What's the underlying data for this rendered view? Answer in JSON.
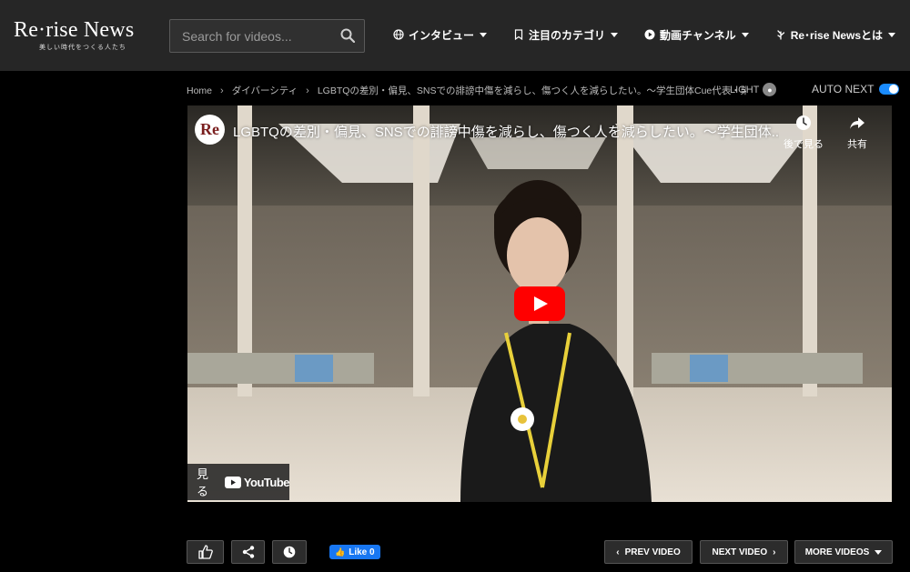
{
  "header": {
    "logo_main": "Re·rise News",
    "logo_sub": "美しい時代をつくる人たち",
    "search_placeholder": "Search for videos...",
    "nav": [
      {
        "label": "インタビュー",
        "icon": "globe-icon"
      },
      {
        "label": "注目のカテゴリ",
        "icon": "bookmark-icon"
      },
      {
        "label": "動画チャンネル",
        "icon": "play-circle-icon"
      },
      {
        "label": "Re･rise Newsとは",
        "icon": "leaf-icon"
      }
    ]
  },
  "breadcrumb": {
    "home": "Home",
    "category": "ダイバーシティ",
    "current": "LGBTQの差別・偏見、SNSでの誹謗中傷を減らし、傷つく人を減らしたい。〜学生団体Cue代表・柴田"
  },
  "light_label": "LIGHT",
  "autonext_label": "AUTO NEXT",
  "video": {
    "channel_initials": "Re",
    "title": "LGBTQの差別・偏見、SNSでの誹謗中傷を減らし、傷つく人を減らしたい。〜学生団体...",
    "watch_later": "後で見る",
    "share": "共有",
    "watch_on": "見る",
    "youtube": "YouTube"
  },
  "actions": {
    "fb_like": "Like 0",
    "prev": "PREV VIDEO",
    "next": "NEXT VIDEO",
    "more": "MORE VIDEOS"
  },
  "colors": {
    "header_bg": "#262626",
    "accent_blue": "#1a8cff",
    "youtube_red": "#ff0000",
    "facebook_blue": "#1877f2"
  }
}
